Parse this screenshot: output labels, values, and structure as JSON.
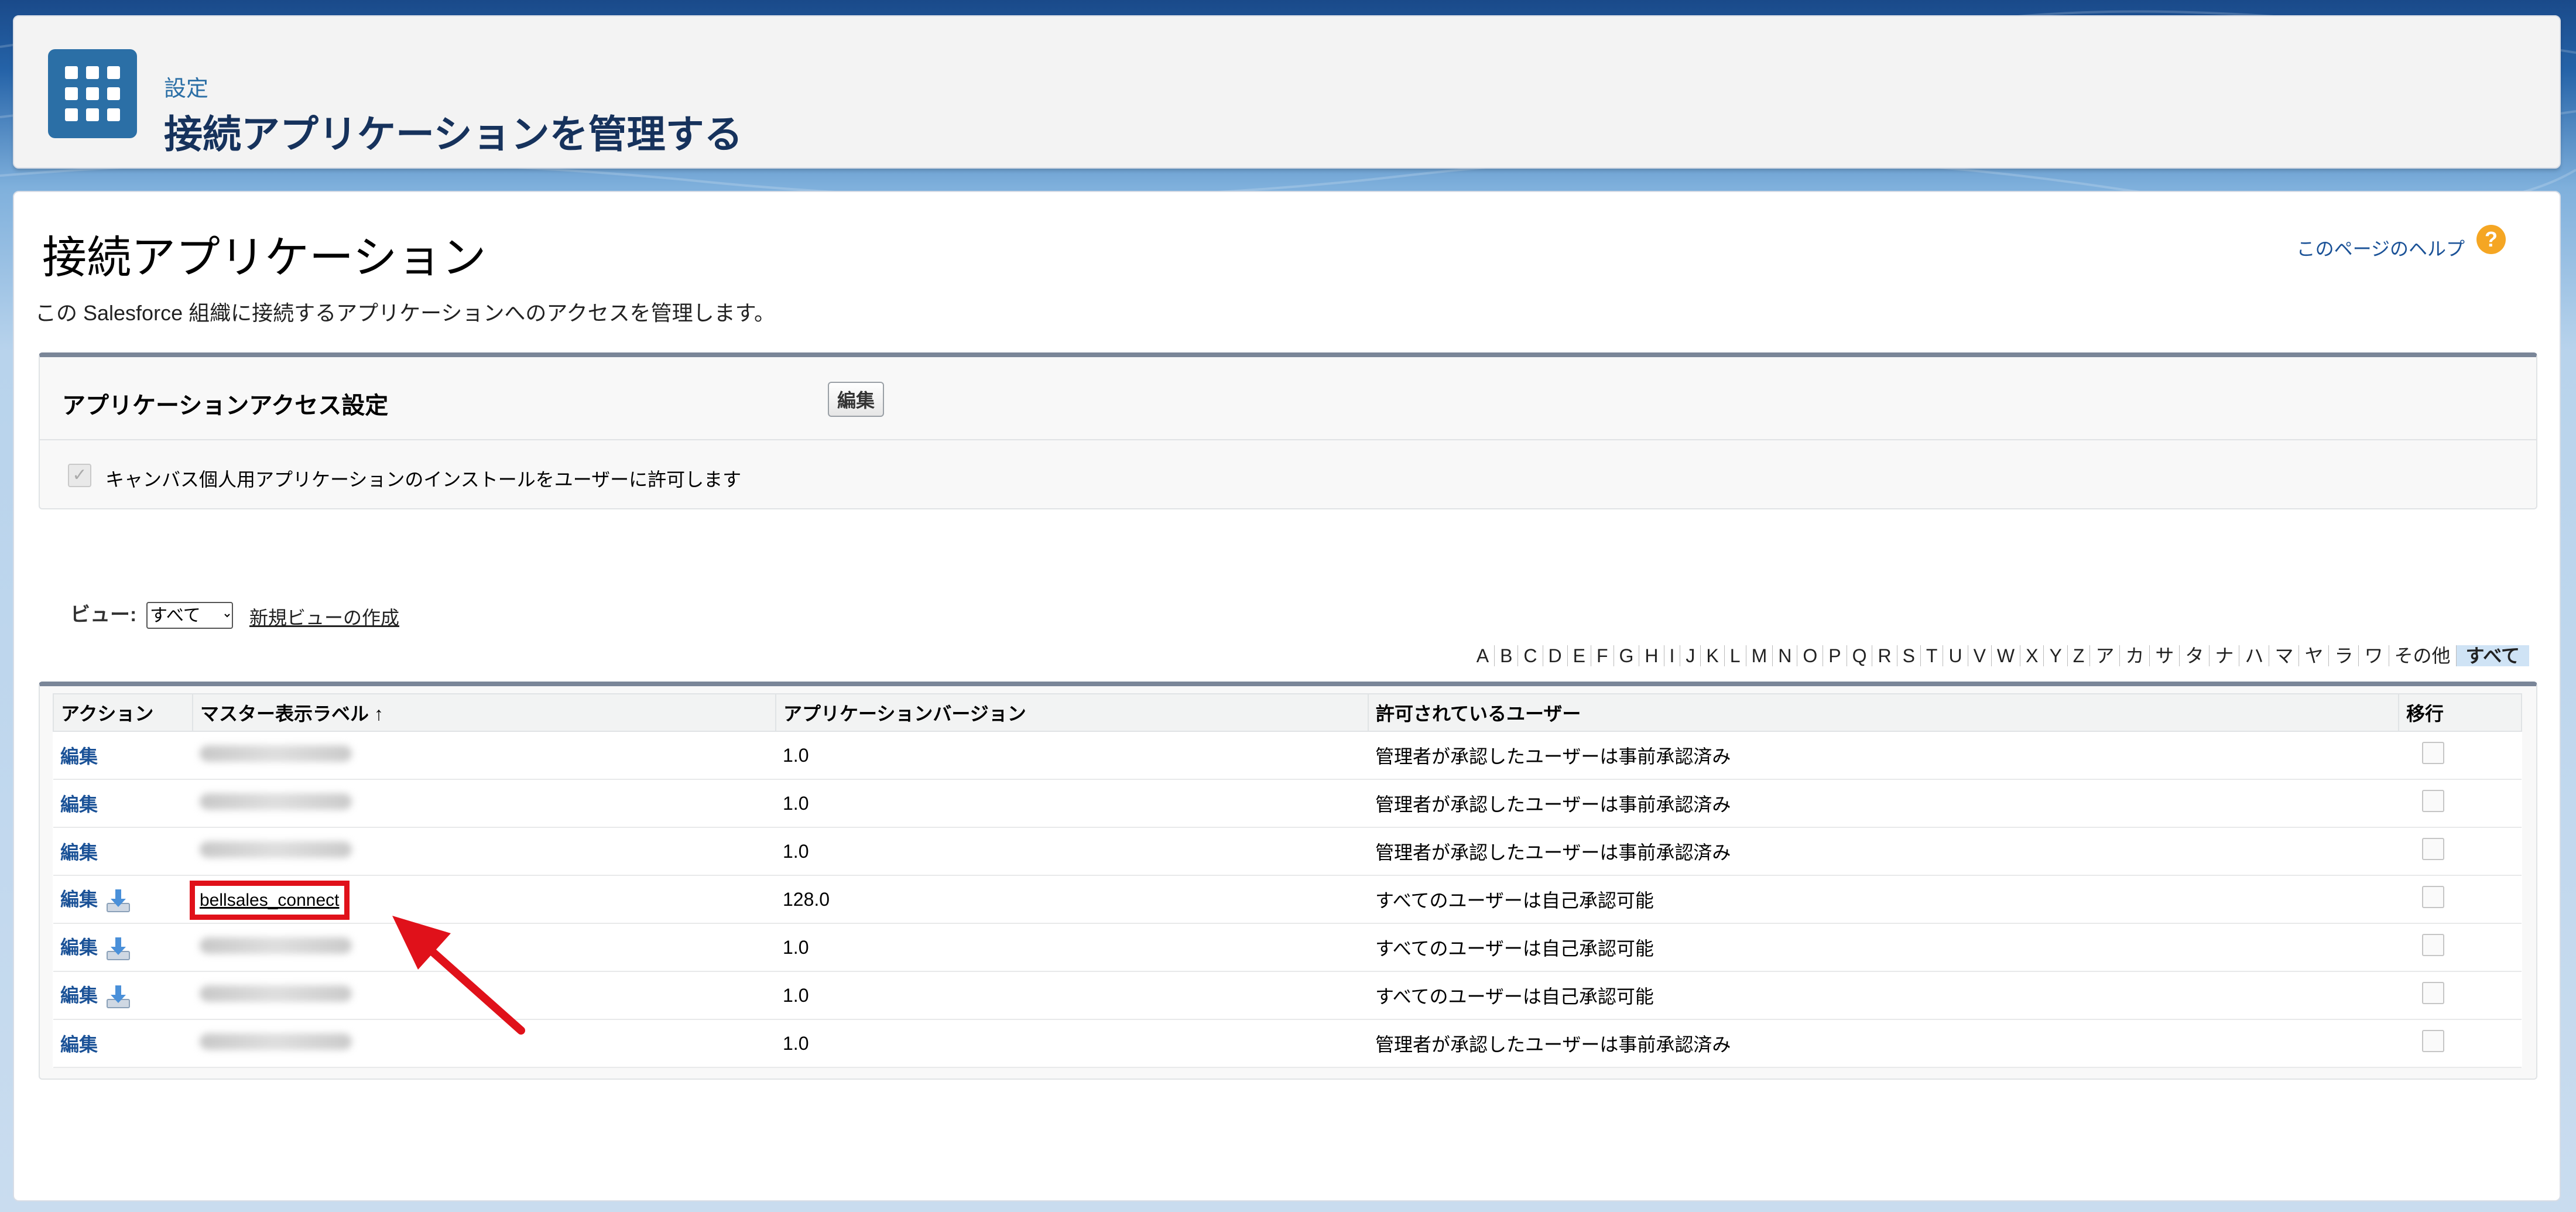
{
  "header": {
    "eyebrow": "設定",
    "title": "接続アプリケーションを管理する"
  },
  "page": {
    "title": "接続アプリケーション",
    "description": "この Salesforce 組織に接続するアプリケーションへのアクセスを管理します。",
    "help_link": "このページのヘルプ",
    "help_icon": "?"
  },
  "access_settings": {
    "title": "アプリケーションアクセス設定",
    "edit_label": "編集",
    "checkbox_label": "キャンバス個人用アプリケーションのインストールをユーザーに許可します",
    "checkbox_checked": true
  },
  "view": {
    "label": "ビュー:",
    "selected": "すべて",
    "new_view_link": "新規ビューの作成"
  },
  "alphabet": [
    "A",
    "B",
    "C",
    "D",
    "E",
    "F",
    "G",
    "H",
    "I",
    "J",
    "K",
    "L",
    "M",
    "N",
    "O",
    "P",
    "Q",
    "R",
    "S",
    "T",
    "U",
    "V",
    "W",
    "X",
    "Y",
    "Z",
    "ア",
    "カ",
    "サ",
    "タ",
    "ナ",
    "ハ",
    "マ",
    "ヤ",
    "ラ",
    "ワ",
    "その他",
    "すべて"
  ],
  "alphabet_active": "すべて",
  "table": {
    "columns": [
      "アクション",
      "マスター表示ラベル ↑",
      "アプリケーションバージョン",
      "許可されているユーザー",
      "移行"
    ],
    "rows": [
      {
        "action": "編集",
        "download": false,
        "label": "",
        "blurred": true,
        "version": "1.0",
        "users": "管理者が承認したユーザーは事前承認済み"
      },
      {
        "action": "編集",
        "download": false,
        "label": "",
        "blurred": true,
        "version": "1.0",
        "users": "管理者が承認したユーザーは事前承認済み"
      },
      {
        "action": "編集",
        "download": false,
        "label": "",
        "blurred": true,
        "version": "1.0",
        "users": "管理者が承認したユーザーは事前承認済み"
      },
      {
        "action": "編集",
        "download": true,
        "label": "bellsales_connect",
        "blurred": false,
        "highlighted": true,
        "version": "128.0",
        "users": "すべてのユーザーは自己承認可能"
      },
      {
        "action": "編集",
        "download": true,
        "label": "",
        "blurred": true,
        "version": "1.0",
        "users": "すべてのユーザーは自己承認可能"
      },
      {
        "action": "編集",
        "download": true,
        "label": "",
        "blurred": true,
        "version": "1.0",
        "users": "すべてのユーザーは自己承認可能"
      },
      {
        "action": "編集",
        "download": false,
        "label": "",
        "blurred": true,
        "version": "1.0",
        "users": "管理者が承認したユーザーは事前承認済み"
      }
    ]
  },
  "colors": {
    "accent": "#2b6fa6",
    "link": "#1b5297",
    "highlight": "#e0111a"
  },
  "icons": {
    "header": "app-launcher-grid-icon",
    "help": "help-question-icon",
    "download": "download-tray-icon",
    "annotation": "red-arrow-icon"
  }
}
